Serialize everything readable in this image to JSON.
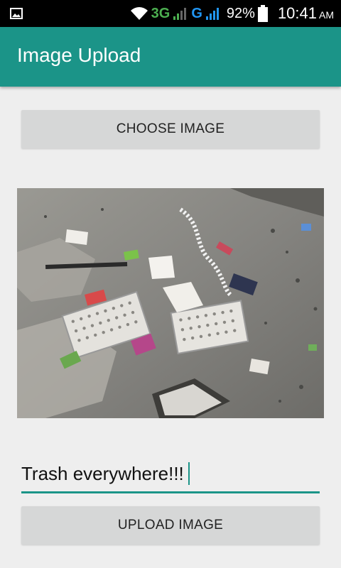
{
  "status_bar": {
    "network_3g": "3G",
    "network_g": "G",
    "battery": "92%",
    "time": "10:41",
    "ampm": "AM"
  },
  "app_bar": {
    "title": "Image Upload"
  },
  "main": {
    "choose_button_label": "CHOOSE IMAGE",
    "caption_value": "Trash everywhere!!!",
    "upload_button_label": "UPLOAD IMAGE"
  },
  "colors": {
    "accent": "#1b9488",
    "button": "#d6d7d7",
    "background": "#eeeeee"
  }
}
